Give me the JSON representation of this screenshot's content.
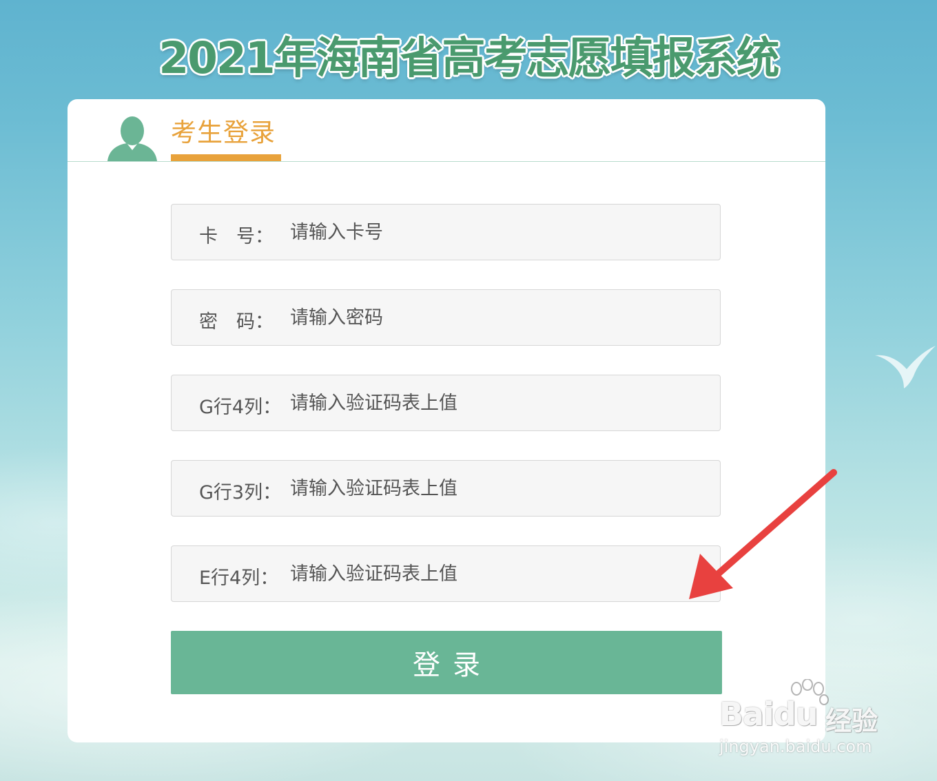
{
  "page": {
    "title": "2021年海南省高考志愿填报系统"
  },
  "login_tab": {
    "label": "考生登录"
  },
  "fields": [
    {
      "label": "卡　号：",
      "placeholder": "请输入卡号"
    },
    {
      "label": "密　码：",
      "placeholder": "请输入密码"
    },
    {
      "label": "G行4列：",
      "placeholder": "请输入验证码表上值"
    },
    {
      "label": "G行3列：",
      "placeholder": "请输入验证码表上值"
    },
    {
      "label": "E行4列：",
      "placeholder": "请输入验证码表上值"
    }
  ],
  "login_button": {
    "label": "登录"
  },
  "watermark": {
    "logo_text": "Baidu",
    "product": "经验",
    "url": "jingyan.baidu.com"
  },
  "colors": {
    "title_green": "#4a9a6e",
    "accent_orange": "#e8a23b",
    "button_green": "#69b696",
    "arrow_red": "#e8413f"
  },
  "icons": {
    "tab_icon": "user-icon",
    "annotation": "red-arrow-icon",
    "background_decoration": "bird-icon"
  }
}
